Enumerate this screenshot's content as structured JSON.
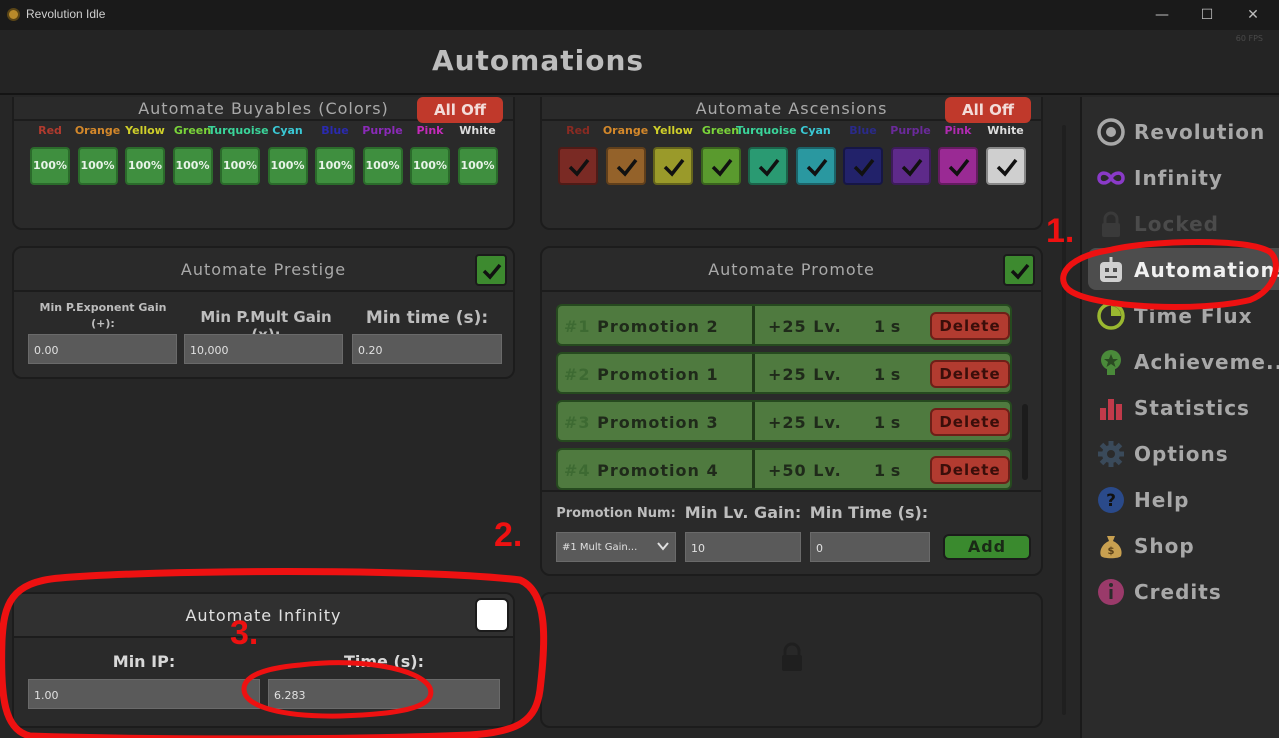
{
  "window": {
    "title": "Revolution Idle",
    "minimize": "—",
    "maximize": "☐",
    "close": "✕"
  },
  "header": {
    "title": "Automations",
    "fps": "60 FPS"
  },
  "buyables": {
    "title": "Automate Buyables (Colors)",
    "all_off": "All Off",
    "colors": [
      {
        "name": "Red",
        "value": "100%",
        "color": "#b03a2e"
      },
      {
        "name": "Orange",
        "value": "100%",
        "color": "#d4882a"
      },
      {
        "name": "Yellow",
        "value": "100%",
        "color": "#cfcf2a"
      },
      {
        "name": "Green",
        "value": "100%",
        "color": "#7ad43a"
      },
      {
        "name": "Turquoise",
        "value": "100%",
        "color": "#3ad49a"
      },
      {
        "name": "Cyan",
        "value": "100%",
        "color": "#3ac8d4"
      },
      {
        "name": "Blue",
        "value": "100%",
        "color": "#2a2ab0"
      },
      {
        "name": "Purple",
        "value": "100%",
        "color": "#8a2ab8"
      },
      {
        "name": "Pink",
        "value": "100%",
        "color": "#c42ab8"
      },
      {
        "name": "White",
        "value": "100%",
        "color": "#dddddd"
      }
    ]
  },
  "ascensions": {
    "title": "Automate Ascensions",
    "all_off": "All Off",
    "colors": [
      {
        "name": "Red",
        "color": "#7a2a24",
        "label_color": "#8a2a22"
      },
      {
        "name": "Orange",
        "color": "#94622a",
        "label_color": "#d4882a"
      },
      {
        "name": "Yellow",
        "color": "#9a9a2a",
        "label_color": "#cfcf2a"
      },
      {
        "name": "Green",
        "color": "#5a9a2e",
        "label_color": "#7ad43a"
      },
      {
        "name": "Turquoise",
        "color": "#2a9a72",
        "label_color": "#3ad49a"
      },
      {
        "name": "Cyan",
        "color": "#2a98a0",
        "label_color": "#3ac8d4"
      },
      {
        "name": "Blue",
        "color": "#22226a",
        "label_color": "#2a2a8a"
      },
      {
        "name": "Purple",
        "color": "#5e2a8a",
        "label_color": "#6a2a9a"
      },
      {
        "name": "Pink",
        "color": "#9a2a94",
        "label_color": "#b02ab0"
      },
      {
        "name": "White",
        "color": "#cfcfcf",
        "label_color": "#dddddd"
      }
    ]
  },
  "prestige": {
    "title": "Automate Prestige",
    "exp_label": "Min P.Exponent Gain (+):",
    "mult_label": "Min P.Mult Gain (x):",
    "time_label": "Min time (s):",
    "exp_value": "0.00",
    "mult_value": "10,000",
    "time_value": "0.20"
  },
  "promote": {
    "title": "Automate Promote",
    "rows": [
      {
        "num": "#1",
        "name": "Promotion 2",
        "lv": "+25 Lv.",
        "time": "1 s",
        "delete": "Delete"
      },
      {
        "num": "#2",
        "name": "Promotion 1",
        "lv": "+25 Lv.",
        "time": "1 s",
        "delete": "Delete"
      },
      {
        "num": "#3",
        "name": "Promotion 3",
        "lv": "+25 Lv.",
        "time": "1 s",
        "delete": "Delete"
      },
      {
        "num": "#4",
        "name": "Promotion 4",
        "lv": "+50 Lv.",
        "time": "1 s",
        "delete": "Delete"
      }
    ],
    "num_label": "Promotion Num:",
    "lv_label": "Min Lv. Gain:",
    "time_label": "Min Time (s):",
    "select_value": "#1 Mult Gain...",
    "lv_value": "10",
    "time_value": "0",
    "add": "Add"
  },
  "infinity": {
    "title": "Automate Infinity",
    "ip_label": "Min IP:",
    "time_label": "Time (s):",
    "ip_value": "1.00",
    "time_value": "6.283"
  },
  "sidebar": {
    "items": [
      {
        "label": "Revolution",
        "icon": "revolution-icon"
      },
      {
        "label": "Infinity",
        "icon": "infinity-icon"
      },
      {
        "label": "Locked",
        "icon": "lock-icon"
      },
      {
        "label": "Automations",
        "icon": "robot-icon"
      },
      {
        "label": "Time Flux",
        "icon": "time-flux-icon"
      },
      {
        "label": "Achieveme...",
        "icon": "achievement-icon"
      },
      {
        "label": "Statistics",
        "icon": "statistics-icon"
      },
      {
        "label": "Options",
        "icon": "gear-icon"
      },
      {
        "label": "Help",
        "icon": "help-icon"
      },
      {
        "label": "Shop",
        "icon": "money-bag-icon"
      },
      {
        "label": "Credits",
        "icon": "info-icon"
      }
    ]
  },
  "annotations": {
    "one": "1.",
    "two": "2.",
    "three": "3."
  }
}
